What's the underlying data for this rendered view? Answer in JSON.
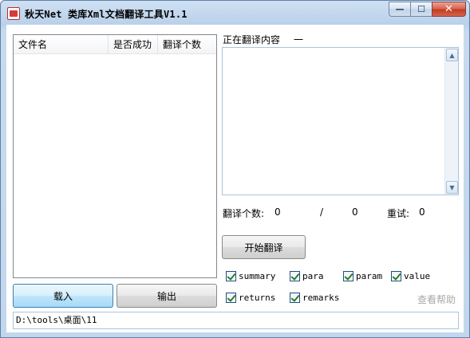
{
  "window": {
    "title": "秋天Net 类库Xml文档翻译工具V1.1",
    "minimize_glyph": "—",
    "maximize_glyph": "☐",
    "close_glyph": "✕"
  },
  "file_list": {
    "columns": [
      "文件名",
      "是否成功",
      "翻译个数"
    ],
    "rows": []
  },
  "buttons": {
    "load": "载入",
    "output": "输出",
    "start": "开始翻译"
  },
  "translating": {
    "label": "正在翻译内容",
    "value": "一",
    "content": ""
  },
  "stats": {
    "count_label": "翻译个数:",
    "count_value": "0",
    "separator": "/",
    "total_value": "0",
    "retry_label": "重试:",
    "retry_value": "0"
  },
  "options": [
    {
      "label": "summary",
      "checked": true
    },
    {
      "label": "para",
      "checked": true
    },
    {
      "label": "param",
      "checked": true
    },
    {
      "label": "value",
      "checked": true
    },
    {
      "label": "returns",
      "checked": true
    },
    {
      "label": "remarks",
      "checked": true
    }
  ],
  "help_link": "查看帮助",
  "path": "D:\\tools\\桌面\\11",
  "icons": {
    "app": "app-icon",
    "scroll_up": "scroll-up-icon",
    "scroll_down": "scroll-down-icon"
  }
}
